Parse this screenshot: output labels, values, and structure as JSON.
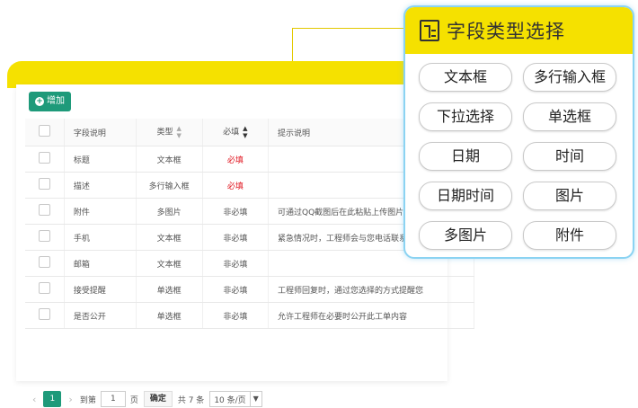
{
  "toolbar": {
    "add_label": "增加"
  },
  "table": {
    "headers": {
      "desc": "字段说明",
      "type": "类型",
      "required": "必填",
      "hint": "提示说明"
    },
    "rows": [
      {
        "desc": "标题",
        "type": "文本框",
        "required": "必填",
        "hint": ""
      },
      {
        "desc": "描述",
        "type": "多行输入框",
        "required": "必填",
        "hint": ""
      },
      {
        "desc": "附件",
        "type": "多图片",
        "required": "非必填",
        "hint": "可通过QQ截图后在此粘贴上传图片"
      },
      {
        "desc": "手机",
        "type": "文本框",
        "required": "非必填",
        "hint": "紧急情况时，工程师会与您电话联系。"
      },
      {
        "desc": "邮箱",
        "type": "文本框",
        "required": "非必填",
        "hint": ""
      },
      {
        "desc": "接受提醒",
        "type": "单选框",
        "required": "非必填",
        "hint": "工程师回复时，通过您选择的方式提醒您"
      },
      {
        "desc": "是否公开",
        "type": "单选框",
        "required": "非必填",
        "hint": "允许工程师在必要时公开此工单内容"
      }
    ]
  },
  "pager": {
    "current_page": "1",
    "goto_prefix": "到第",
    "goto_value": "1",
    "goto_suffix": "页",
    "confirm_label": "确定",
    "total_label": "共 7 条",
    "page_size": "10 条/页"
  },
  "popup": {
    "title": "字段类型选择",
    "options": [
      "文本框",
      "多行输入框",
      "下拉选择",
      "单选框",
      "日期",
      "时间",
      "日期时间",
      "图片",
      "多图片",
      "附件"
    ]
  },
  "colors": {
    "accent_green": "#1e9a7a",
    "brand_yellow": "#f5e100",
    "required_red": "#e0141e",
    "popup_border": "#8bd3f2"
  }
}
